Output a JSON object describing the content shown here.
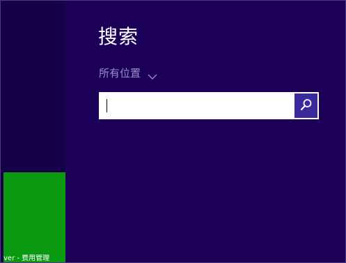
{
  "search": {
    "title": "搜索",
    "scope_label": "所有位置",
    "input_value": "",
    "button_icon": "search-icon"
  },
  "start_tile": {
    "label": "ver - 费用管理"
  },
  "colors": {
    "background": "#1c0058",
    "left_strip": "#160047",
    "tile": "#0a9a11",
    "scope_text": "#9a8ccf",
    "search_button": "#3a2a9e"
  }
}
